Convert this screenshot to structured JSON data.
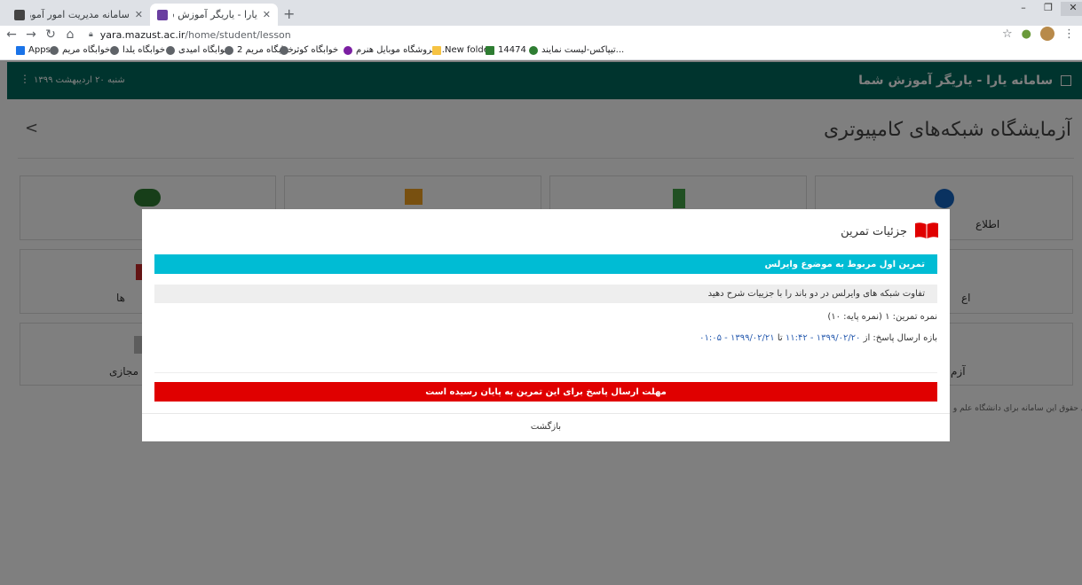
{
  "browser": {
    "tabs": [
      {
        "title": "سامانه مدیریت امور آموزش",
        "active": false
      },
      {
        "title": "یارا - یاریگر آموزش شما :",
        "active": true
      }
    ],
    "url_host": "yara.mazust.ac.ir",
    "url_path": "/home/student/lesson",
    "bookmarks": [
      "Apps",
      "خوابگاه مریم",
      "خوابگاه یلدا",
      "خوابگاه امیدی",
      "خوابگاه مریم 2",
      "خوابگاه کوثر",
      "فروشگاه موبایل هنرم...",
      "New folder",
      "14474",
      "تیپاکس-لیست نمایند..."
    ]
  },
  "app": {
    "brand": "سامانه یارا - یاریگر آموزش شما",
    "date": "شنبه ۲۰ اردیبهشت ۱۳۹۹",
    "page_title": "آزمایشگاه شبکه‌های کامپیوتری",
    "footer": "© تمامی حقوق این سامانه برای دانشگاه علم و..."
  },
  "cards_partial": {
    "c1_label": "اطلاع",
    "c2_label": "ع",
    "c3_label": "ها",
    "c4_label": "مجازی",
    "c5_label": "آزم",
    "c6_label": "اع"
  },
  "modal": {
    "title": "جزئیات تمرین",
    "exercise_title": "تمرین اول مربوط به موضوع وایرلس",
    "description": "تفاوت شبکه های وایرلس در دو باند را با جزییات شرح دهید",
    "grade": "نمره تمرین: ۱ (نمره پایه: ۱۰)",
    "range_label": "بازه ارسال پاسخ: از",
    "range_from": "۱۳۹۹/۰۲/۲۰ - ۱۱:۴۲",
    "range_sep": "تا",
    "range_to": "۱۳۹۹/۰۲/۲۱ - ۰۱:۰۵",
    "deadline": "مهلت ارسال پاسخ برای این تمرین به پایان رسیده است",
    "back": "بازگشت"
  },
  "colors": {
    "header": "#00695c",
    "info_bar": "#00bcd4",
    "deadline_bar": "#e00000",
    "book_icon": "#e00000"
  }
}
